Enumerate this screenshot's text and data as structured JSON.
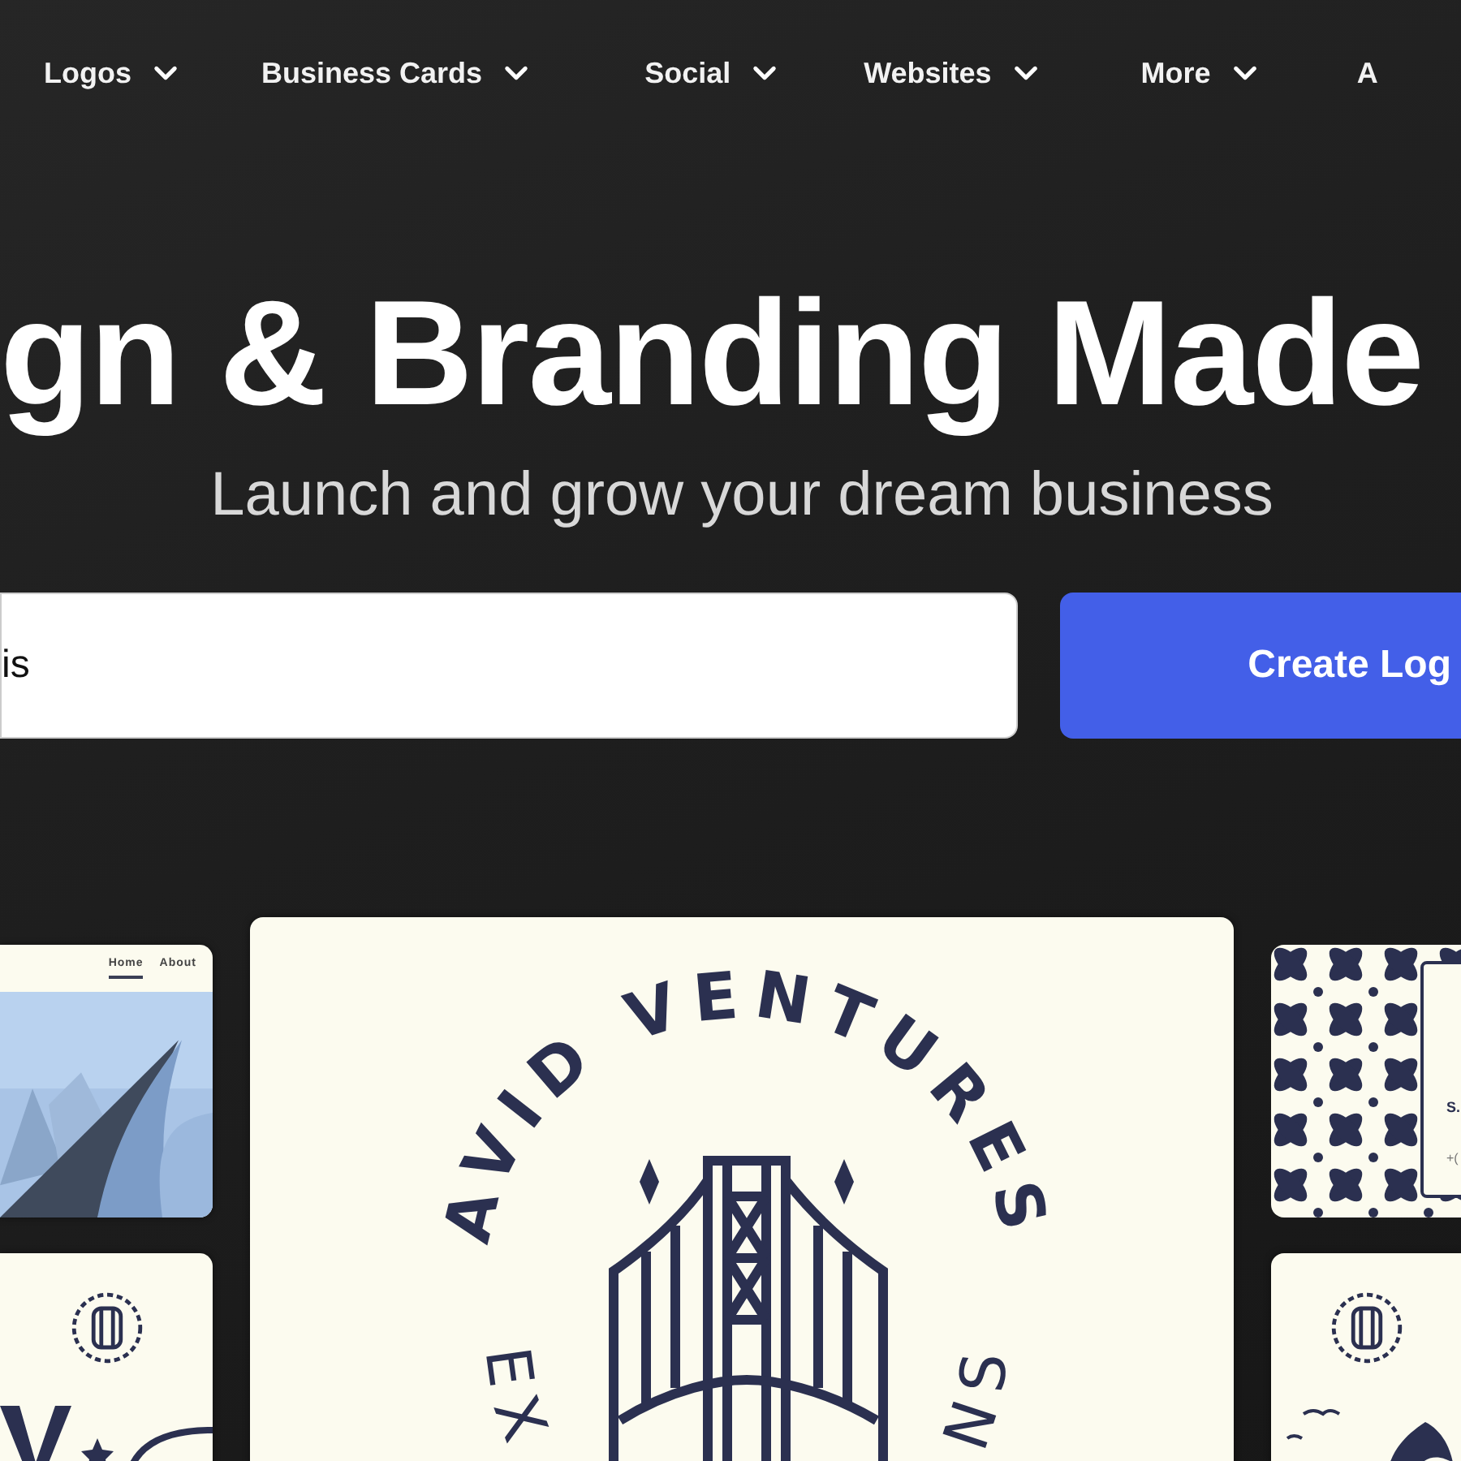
{
  "nav": [
    {
      "label": "Logos",
      "dropdown": true
    },
    {
      "label": "Business Cards",
      "dropdown": true
    },
    {
      "label": "Social",
      "dropdown": true
    },
    {
      "label": "Websites",
      "dropdown": true
    },
    {
      "label": "More",
      "dropdown": true
    },
    {
      "label": "A",
      "dropdown": false
    }
  ],
  "hero": {
    "title": "gn & Branding Made",
    "subtitle": "Launch and grow your dream business"
  },
  "search": {
    "value": "is"
  },
  "cta": {
    "label": "Create Log"
  },
  "website_mock": {
    "links": [
      {
        "label": "Home",
        "selected": true
      },
      {
        "label": "About",
        "selected": false
      }
    ]
  },
  "logo_card": {
    "arc_top": "AVID VENTURES",
    "arc_bottom_left": "EX",
    "arc_bottom_right": "NS"
  },
  "business_card": {
    "name": "S.",
    "phone": "+("
  }
}
